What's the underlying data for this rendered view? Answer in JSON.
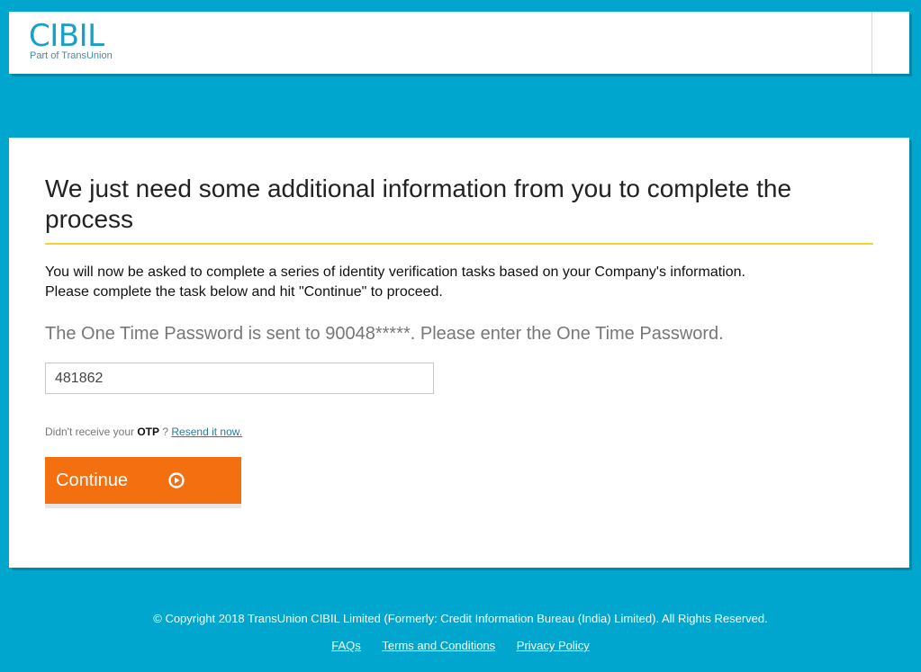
{
  "header": {
    "logo_text": "CIBIL",
    "logo_subtitle": "Part of TransUnion"
  },
  "main": {
    "title": "We just need some additional information from you to complete the process",
    "intro_line1": "You will now be asked to complete a series of identity verification tasks based on your Company's information.",
    "intro_line2": "Please complete the task below and hit \"Continue\" to proceed.",
    "otp_message": "The One Time Password is sent to 90048*****. Please enter the One Time Password.",
    "otp_value": "481862",
    "resend_prefix": "Didn't receive your",
    "resend_otp_word": "OTP",
    "resend_question": "?",
    "resend_link": "Resend it now.",
    "continue_label": "Continue",
    "continue_icon": "play-circle-icon"
  },
  "footer": {
    "copyright": "© Copyright 2018 TransUnion CIBIL Limited (Formerly: Credit Information Bureau (India) Limited). All Rights Reserved.",
    "links": [
      "FAQs",
      "Terms and Conditions",
      "Privacy Policy"
    ]
  },
  "colors": {
    "background": "#00a6ce",
    "accent_button": "#f36f0f",
    "title_rule": "#f6d328",
    "logo": "#1aa0c4"
  }
}
